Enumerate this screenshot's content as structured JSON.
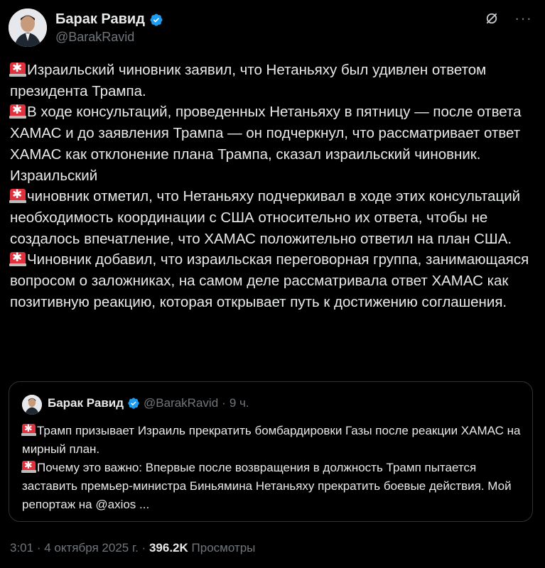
{
  "author": {
    "name": "Барак Равид",
    "handle": "@BarakRavid"
  },
  "tweet": {
    "paragraphs": [
      "Израильский чиновник заявил, что Нетаньяху был удивлен ответом президента Трампа.",
      "В ходе консультаций, проведенных Нетаньяху в пятницу — после ответа ХАМАС и до заявления Трампа — он подчеркнул, что рассматривает ответ ХАМАС как отклонение плана Трампа, сказал израильский чиновник. Израильский",
      "чиновник отметил, что Нетаньяху подчеркивал в ходе этих консультаций необходимость координации с США относительно их ответа, чтобы не создалось впечатление, что ХАМАС положительно ответил на план США.",
      "Чиновник добавил, что израильская переговорная группа, занимающаяся вопросом о заложниках, на самом деле рассматривала ответ ХАМАС как позитивную реакцию, которая открывает путь к достижению соглашения."
    ]
  },
  "quote": {
    "name": "Барак Равид",
    "handle": "@BarakRavid",
    "separator": "·",
    "time": "9 ч.",
    "paragraphs": [
      "Трамп призывает Израиль прекратить бомбардировки Газы после реакции ХАМАС на мирный план.",
      "Почему это важно: Впервые после возвращения в должность Трамп пытается заставить премьер-министра Биньямина Нетаньяху прекратить боевые действия. Мой репортаж на @axios ..."
    ]
  },
  "footer": {
    "time": "3:01",
    "sep1": "·",
    "date": "4 октября 2025 г.",
    "sep2": "·",
    "views_count": "396.2K",
    "views_label": "Просмотры"
  },
  "icons": {
    "verified": "verified-badge-icon",
    "grok": "grok-icon",
    "more": "more-icon",
    "alarm": "police-light-icon"
  },
  "colors": {
    "background": "#000000",
    "text": "#e7e9ea",
    "muted": "#71767b",
    "verified": "#1d9bf0",
    "alarm": "#e0313c",
    "border": "#2f3336"
  }
}
